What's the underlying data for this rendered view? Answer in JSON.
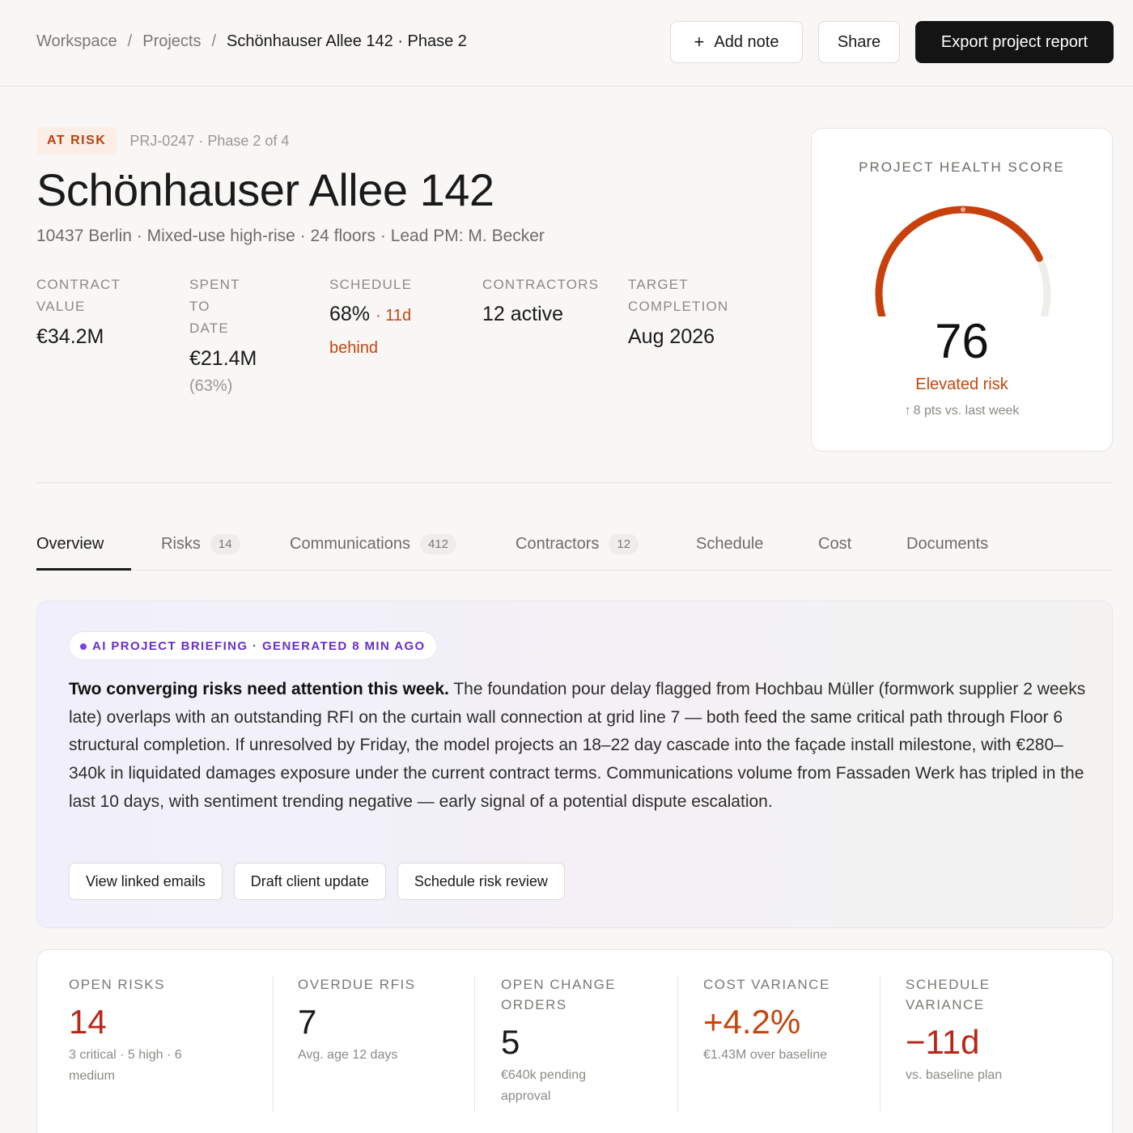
{
  "breadcrumb": {
    "items": [
      "Workspace",
      "Projects"
    ],
    "separator": "/",
    "current": "Schönhauser Allee 142 · Phase 2"
  },
  "actions": {
    "add_note": "Add note",
    "share": "Share",
    "export": "Export project report"
  },
  "project": {
    "status_badge": "AT RISK",
    "id_line": "PRJ-0247 · Phase 2 of 4",
    "title": "Schönhauser Allee 142",
    "subtitle": "10437 Berlin · Mixed-use high-rise · 24 floors · Lead PM: M. Becker"
  },
  "stats": {
    "contract": {
      "label_1": "CONTRACT",
      "label_2": "VALUE",
      "value": "€34.2M"
    },
    "spent": {
      "label_1": "SPENT TO",
      "label_2": "DATE",
      "value": "€21.4M",
      "note": "(63%)"
    },
    "schedule": {
      "label": "SCHEDULE",
      "value": "68%",
      "behind_1": "· 11d",
      "behind_2": "behind"
    },
    "contractors": {
      "label": "CONTRACTORS",
      "value": "12 active"
    },
    "target": {
      "label_1": "TARGET",
      "label_2": "COMPLETION",
      "value": "Aug 2026"
    }
  },
  "health": {
    "title": "PROJECT HEALTH SCORE",
    "score": "76",
    "score_value": 76,
    "state": "Elevated risk",
    "delta": "8 pts vs. last week",
    "accent_color": "#c8410c",
    "track_color": "#efedea"
  },
  "tabs": [
    {
      "label": "Overview",
      "count": "",
      "active": true
    },
    {
      "label": "Risks",
      "count": "14"
    },
    {
      "label": "Communications",
      "count": "412"
    },
    {
      "label": "Contractors",
      "count": "12"
    },
    {
      "label": "Schedule",
      "count": ""
    },
    {
      "label": "Cost",
      "count": ""
    },
    {
      "label": "Documents",
      "count": ""
    }
  ],
  "briefing": {
    "tag": "AI PROJECT BRIEFING · GENERATED 8 MIN AGO",
    "headline": "Two converging risks need attention this week.",
    "body": " The foundation pour delay flagged from Hochbau Müller (formwork supplier 2 weeks late) overlaps with an outstanding RFI on the curtain wall connection at grid line 7 — both feed the same critical path through Floor 6 structural completion. If unresolved by Friday, the model projects an 18–22 day cascade into the façade install milestone, with €280–340k in liquidated damages exposure under the current contract terms. Communications volume from Fassaden Werk has tripled in the last 10 days, with sentiment trending negative — early signal of a potential dispute escalation.",
    "actions": [
      "View linked emails",
      "Draft client update",
      "Schedule risk review"
    ]
  },
  "metrics": {
    "open_risks": {
      "label": "OPEN RISKS",
      "value": "14",
      "note_1": "3 critical · 5 high · 6",
      "note_2": "medium"
    },
    "overdue_rfis": {
      "label": "OVERDUE RFIS",
      "value": "7",
      "note": "Avg. age 12 days"
    },
    "change_orders": {
      "label_1": "OPEN CHANGE",
      "label_2": "ORDERS",
      "value": "5",
      "note_1": "€640k pending",
      "note_2": "approval"
    },
    "cost_variance": {
      "label": "COST VARIANCE",
      "value": "+4.2%",
      "note": "€1.43M over baseline"
    },
    "schedule_variance": {
      "label_1": "SCHEDULE",
      "label_2": "VARIANCE",
      "value": "−11d",
      "note": "vs. baseline plan"
    }
  }
}
